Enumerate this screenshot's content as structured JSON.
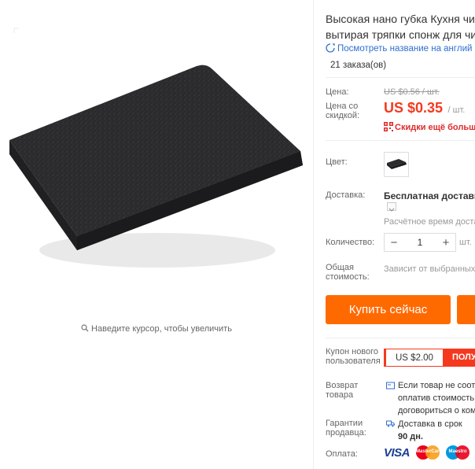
{
  "product": {
    "title_line1": "Высокая нано губка Кухня чис",
    "title_line2": "вытирая тряпки спонж для чис",
    "translate_link": "Посмотреть название на англий",
    "orders": "21 заказа(ов)",
    "zoom_hint": "Наведите курсор, чтобы увеличить"
  },
  "pricing": {
    "price_label": "Цена:",
    "old_price": "US $0.56 / шт.",
    "discount_label_line1": "Цена со",
    "discount_label_line2": "скидкой:",
    "price": "US $0.35",
    "per_unit": "/ шт.",
    "more_discounts": "Скидки ещё больше"
  },
  "options": {
    "color_label": "Цвет:",
    "shipping_label": "Доставка:",
    "shipping_value": "Бесплатная доставка",
    "delivery_estimate": "Расчётное время доста",
    "quantity_label": "Количество:",
    "quantity_minus": "−",
    "quantity_value": "1",
    "quantity_plus": "+",
    "quantity_unit": "шт.",
    "total_label_line1": "Общая",
    "total_label_line2": "стоимость:",
    "total_value": "Зависит от выбранных"
  },
  "actions": {
    "buy_now": "Купить сейчас"
  },
  "coupon": {
    "label_line1": "Купон нового",
    "label_line2": "пользователя",
    "value": "US $2.00",
    "get_label": "ПОЛУ"
  },
  "returns": {
    "label_line1": "Возврат",
    "label_line2": "товара",
    "text_line1": "Если товар не соот",
    "text_line2": "оплатив стоимость",
    "text_line3": "договориться о ком"
  },
  "guarantee": {
    "label_line1": "Гарантии",
    "label_line2": "продавца:",
    "text_line1": "Доставка в срок",
    "text_line2": "90 дн."
  },
  "payment": {
    "label": "Оплата:",
    "visa": "VISA",
    "mastercard": "MasterCard",
    "maestro": "Maestro"
  },
  "colors": {
    "accent": "#ff6a00",
    "price_red": "#f5391f",
    "link_blue": "#2f6fd1",
    "sponge": "#2b2b2d"
  }
}
